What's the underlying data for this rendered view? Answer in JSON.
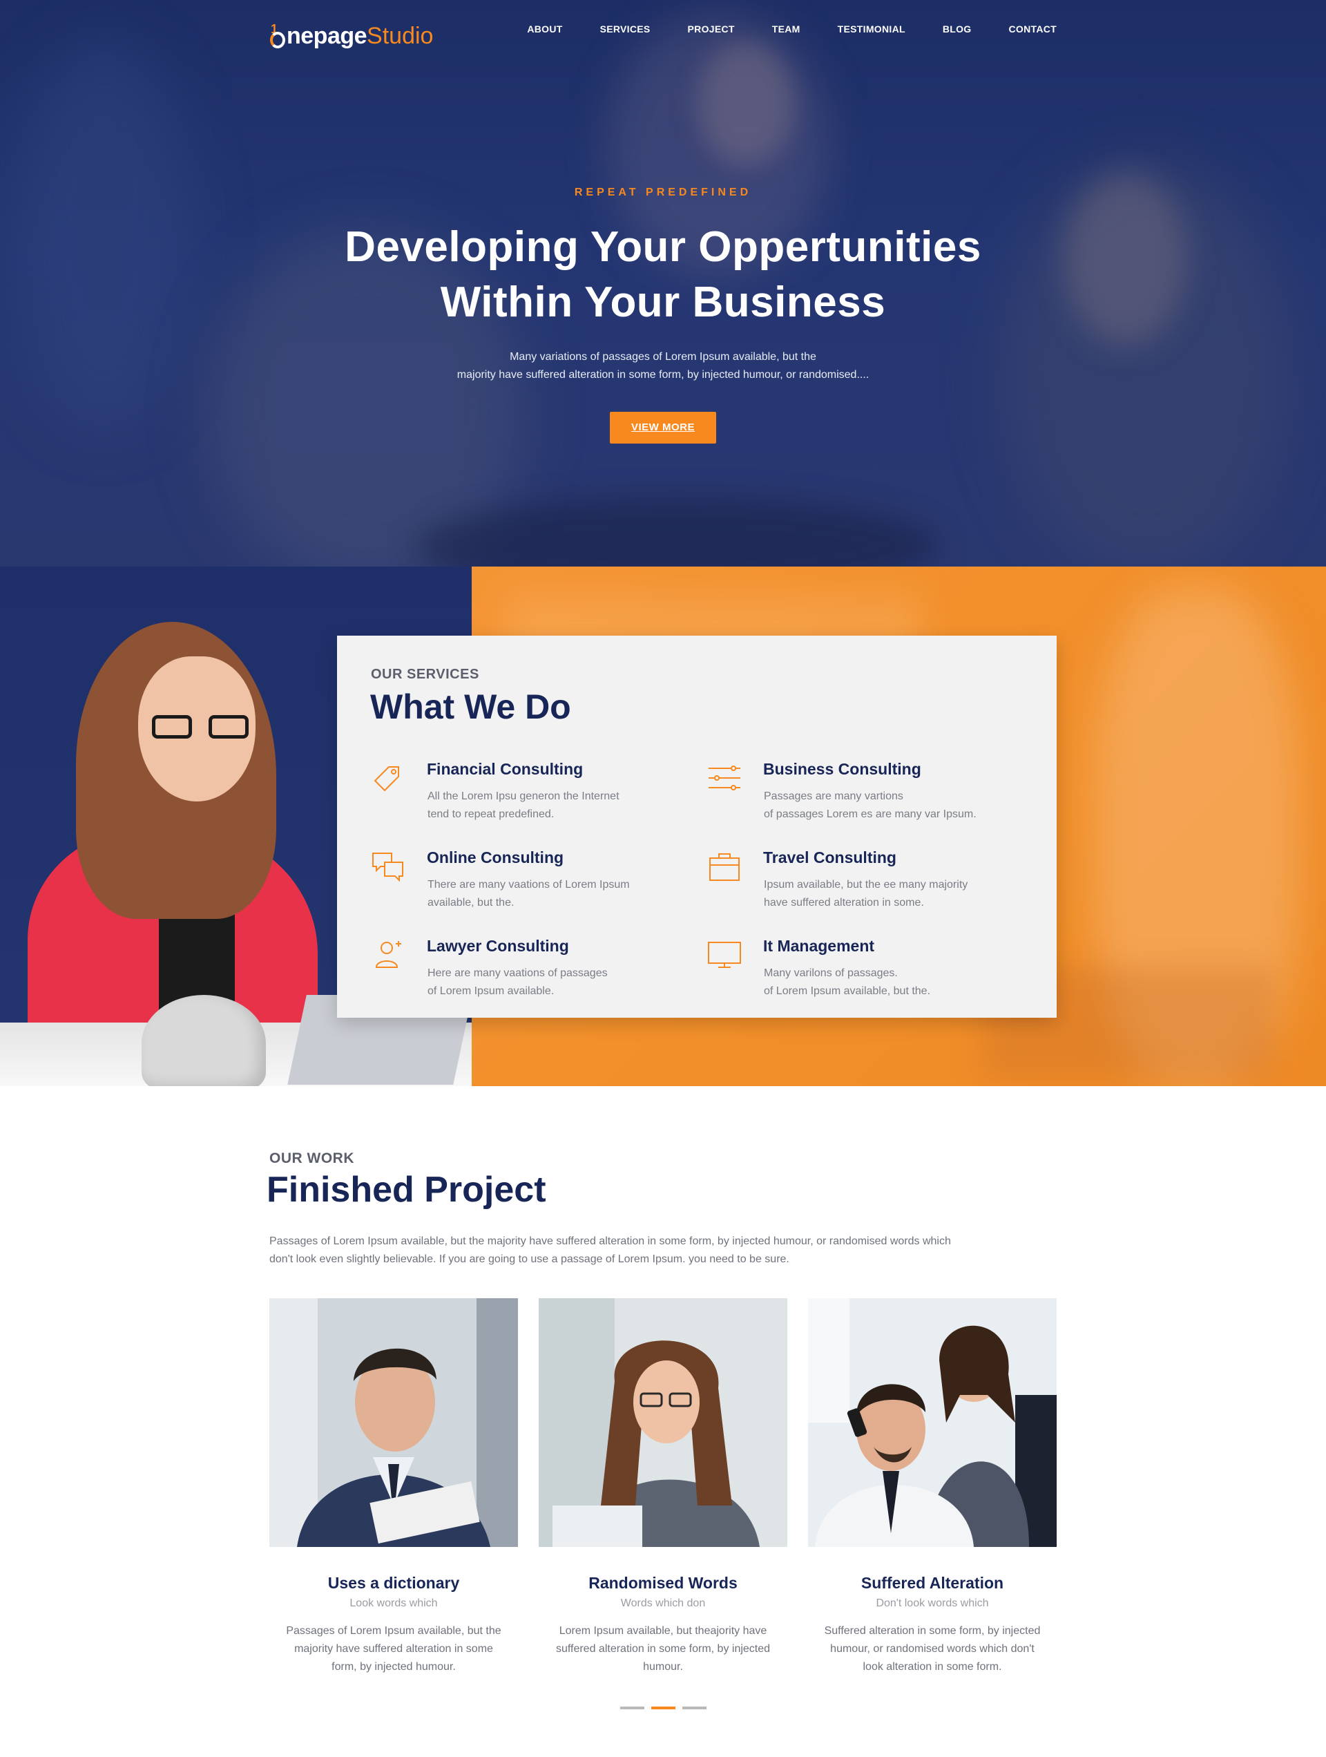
{
  "brand": {
    "logo_one": "1",
    "logo_name": "nepage",
    "logo_suffix": "Studio",
    "accent_color": "#f7891e",
    "navy_color": "#182657"
  },
  "nav": {
    "items": [
      {
        "label": "ABOUT"
      },
      {
        "label": "SERVICES"
      },
      {
        "label": "PROJECT"
      },
      {
        "label": "TEAM"
      },
      {
        "label": "TESTIMONIAL"
      },
      {
        "label": "BLOG"
      },
      {
        "label": "CONTACT"
      }
    ]
  },
  "hero": {
    "eyebrow": "REPEAT PREDEFINED",
    "title_line1": "Developing Your Oppertunities",
    "title_line2": "Within Your Business",
    "text_line1": "Many variations of passages of Lorem Ipsum available, but the",
    "text_line2": "majority have suffered alteration in some form, by injected humour, or randomised....",
    "button": "VIEW MORE"
  },
  "services": {
    "eyebrow": "OUR SERVICES",
    "title": "What We Do",
    "items": [
      {
        "icon": "price-tag-icon",
        "title": "Financial Consulting",
        "line1": "All the Lorem Ipsu generon the Internet",
        "line2": "tend to repeat predefined."
      },
      {
        "icon": "sliders-icon",
        "title": "Business Consulting",
        "line1": "Passages are many vartions",
        "line2": "of passages Lorem es are many var Ipsum."
      },
      {
        "icon": "chat-bubbles-icon",
        "title": "Online Consulting",
        "line1": "There are many vaations of Lorem Ipsum",
        "line2": "available, but the."
      },
      {
        "icon": "briefcase-icon",
        "title": "Travel Consulting",
        "line1": "Ipsum available, but the ee many majority",
        "line2": "have suffered alteration in some."
      },
      {
        "icon": "user-add-icon",
        "title": "Lawyer Consulting",
        "line1": "Here are many vaations of passages",
        "line2": "of Lorem Ipsum available."
      },
      {
        "icon": "monitor-icon",
        "title": "It Management",
        "line1": "Many varilons of passages.",
        "line2": "of Lorem Ipsum available, but the."
      }
    ]
  },
  "work": {
    "eyebrow": "OUR WORK",
    "title": "Finished Project",
    "text_line1": "Passages of Lorem Ipsum available, but the majority have suffered alteration in some form, by injected humour, or randomised words which",
    "text_line2": "don't look even slightly believable. If you are going to use a passage of Lorem Ipsum. you need to be sure.",
    "projects": [
      {
        "title": "Uses a dictionary",
        "subtitle": "Look words which",
        "line1": "Passages of Lorem Ipsum available, but the",
        "line2": "majority have suffered alteration in some",
        "line3": "form, by injected humour."
      },
      {
        "title": "Randomised Words",
        "subtitle": "Words which don",
        "line1": "Lorem Ipsum available, but theajority have",
        "line2": "suffered alteration in some form, by injected",
        "line3": "humour."
      },
      {
        "title": "Suffered Alteration",
        "subtitle": "Don't look words which",
        "line1": "Suffered alteration in some form, by injected",
        "line2": "humour, or randomised words which don't",
        "line3": "look alteration in some form."
      }
    ],
    "carousel": {
      "pages": 3,
      "active": 2
    }
  }
}
